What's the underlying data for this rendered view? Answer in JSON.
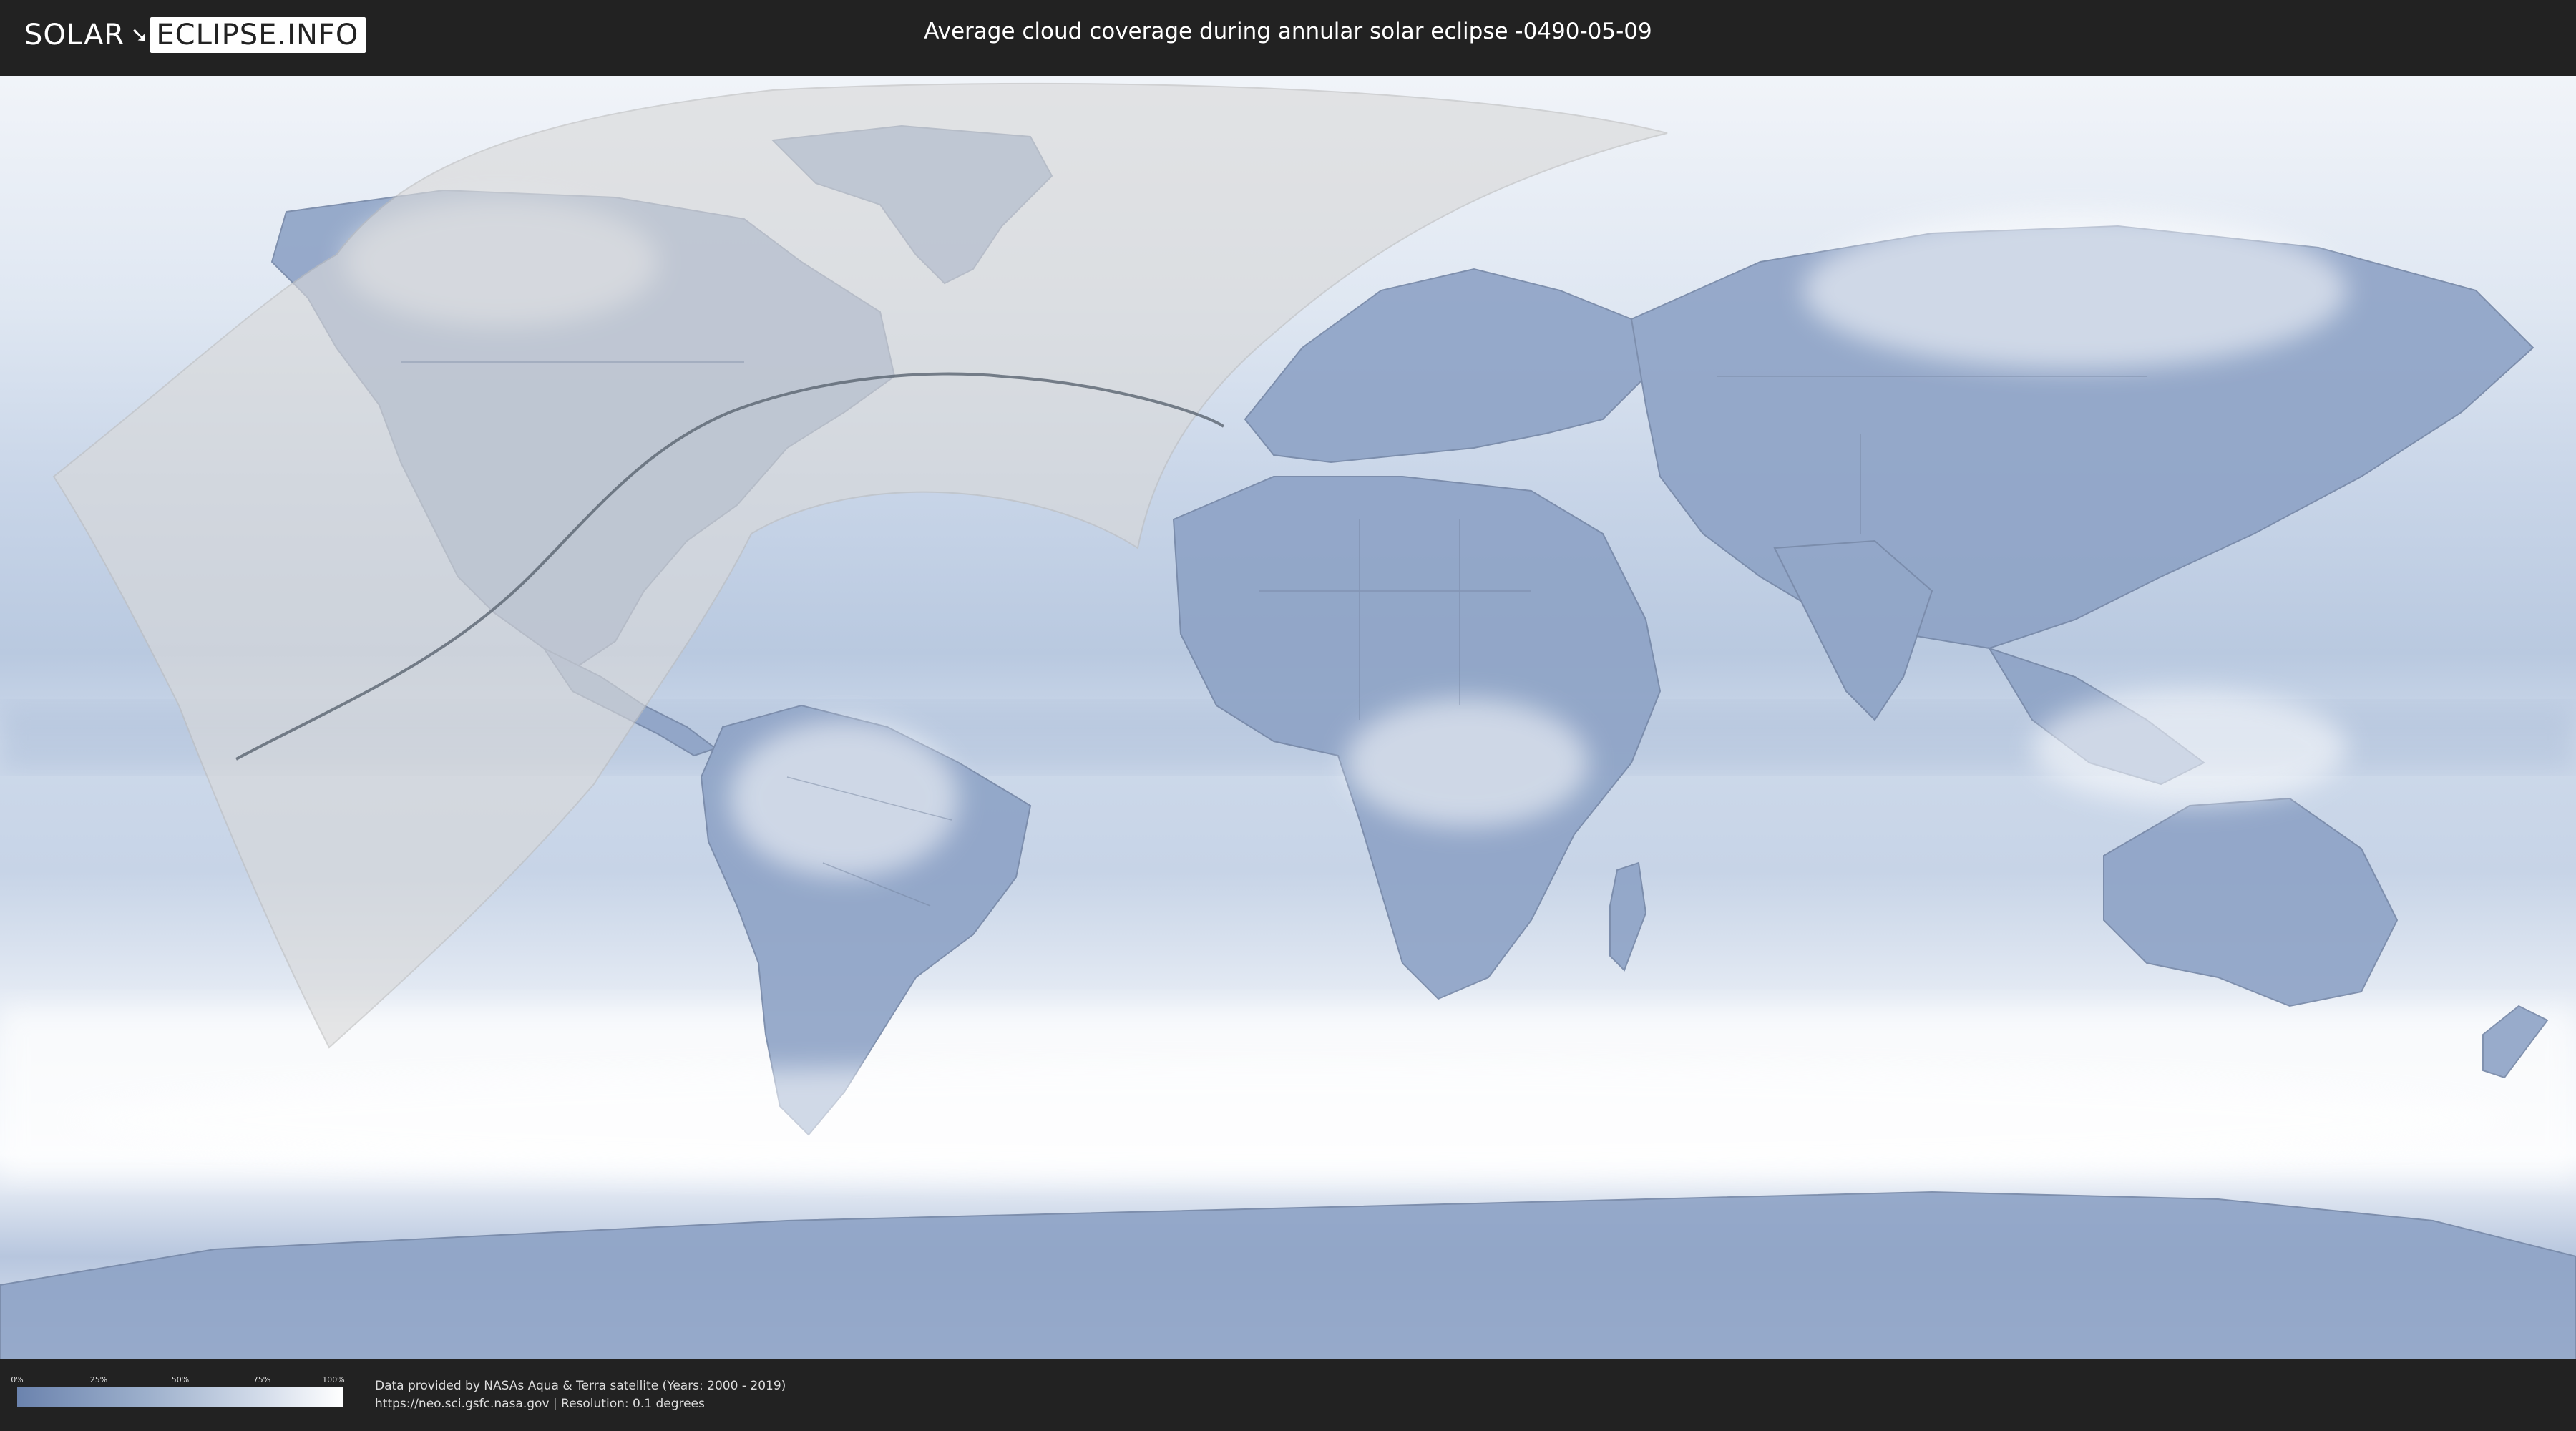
{
  "header": {
    "logo_left": "SOLAR",
    "logo_right": "ECLIPSE.INFO",
    "title": "Average cloud coverage during annular solar eclipse -0490-05-09"
  },
  "map": {
    "ocean_color": "#c3d1e6",
    "land_color": "#8fa5c8",
    "cloud_color": "#f3f6fb",
    "penumbra_color": "#d6d6d6",
    "path_color": "#555f6c"
  },
  "legend": {
    "ticks": [
      "0%",
      "25%",
      "50%",
      "75%",
      "100%"
    ],
    "low_color": "#6b83ae",
    "high_color": "#ffffff"
  },
  "footer": {
    "credit_line1": "Data provided by NASAs Aqua & Terra satellite (Years: 2000 - 2019)",
    "credit_line2": "https://neo.sci.gsfc.nasa.gov | Resolution: 0.1 degrees"
  }
}
